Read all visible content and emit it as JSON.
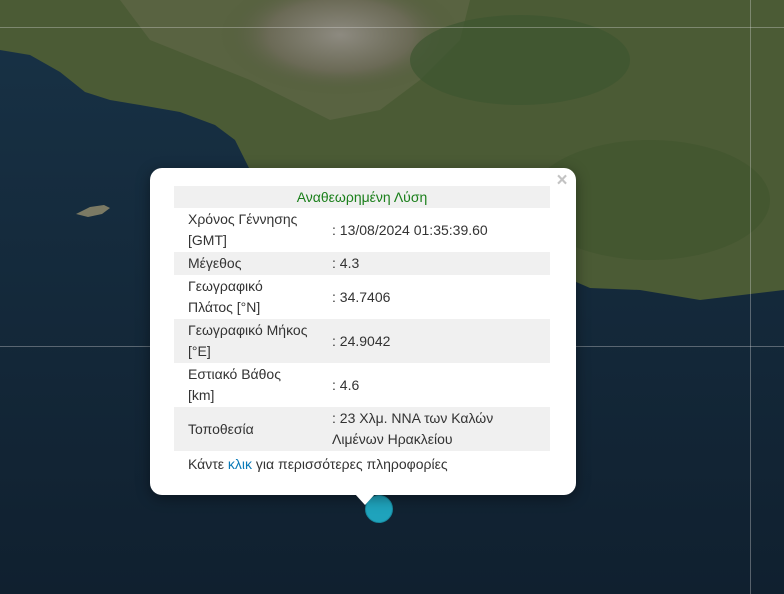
{
  "map": {
    "base_layer": "satellite",
    "land_color": "#4a5a34",
    "sea_color": "#14273a",
    "marker_color": "#1fa3bc"
  },
  "popup": {
    "title": "Αναθεωρημένη Λύση",
    "close_symbol": "×",
    "rows": [
      {
        "label_1": "Χρόνος Γέννησης",
        "label_2": "[GMT]",
        "value": ": 13/08/2024 01:35:39.60"
      },
      {
        "label": "Μέγεθος",
        "value": ": 4.3"
      },
      {
        "label_1": "Γεωγραφικό",
        "label_2": "Πλάτος [°N]",
        "value": ": 34.7406"
      },
      {
        "label_1": "Γεωγραφικό Μήκος",
        "label_2": "[°E]",
        "value": ": 24.9042"
      },
      {
        "label_1": "Εστιακό Βάθος",
        "label_2": "[km]",
        "value": ": 4.6"
      },
      {
        "label": "Τοποθεσία",
        "value_1": ": 23 Χλμ. ΝΝΑ των Καλών",
        "value_2": "Λιμένων Ηρακλείου"
      }
    ],
    "more_prefix": "Κάντε ",
    "more_link": "κλικ",
    "more_suffix": " για περισσότερες πληροφορίες"
  }
}
